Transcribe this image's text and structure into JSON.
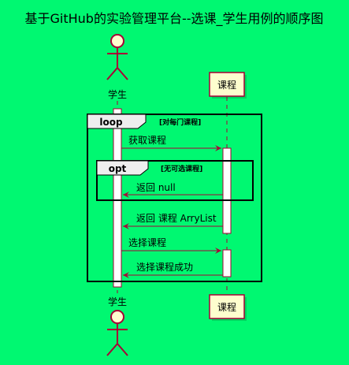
{
  "title": "基于GitHub的实验管理平台--选课_学生用例的顺序图",
  "participants": {
    "student": {
      "label": "学生",
      "kind": "actor"
    },
    "course": {
      "label": "课程",
      "kind": "participant"
    }
  },
  "fragments": {
    "loop": {
      "keyword": "loop",
      "condition": "[对每门课程]"
    },
    "opt": {
      "keyword": "opt",
      "condition": "[无可选课程]"
    }
  },
  "messages": {
    "m1": {
      "text": "获取课程",
      "from": "student",
      "to": "course",
      "style": "solid"
    },
    "m2": {
      "text": "返回 null",
      "from": "course",
      "to": "student",
      "style": "solid"
    },
    "m3": {
      "text": "返回 课程 ArryList",
      "from": "course",
      "to": "student",
      "style": "solid"
    },
    "m4": {
      "text": "选择课程",
      "from": "student",
      "to": "course",
      "style": "solid"
    },
    "m5": {
      "text": "选择课程成功",
      "from": "course",
      "to": "student",
      "style": "solid"
    }
  },
  "colors": {
    "background": "#00F871",
    "arrow": "#A80036",
    "box_fill": "#FEFECE",
    "box_stroke": "#A80036",
    "fragment_stroke": "#000000"
  }
}
